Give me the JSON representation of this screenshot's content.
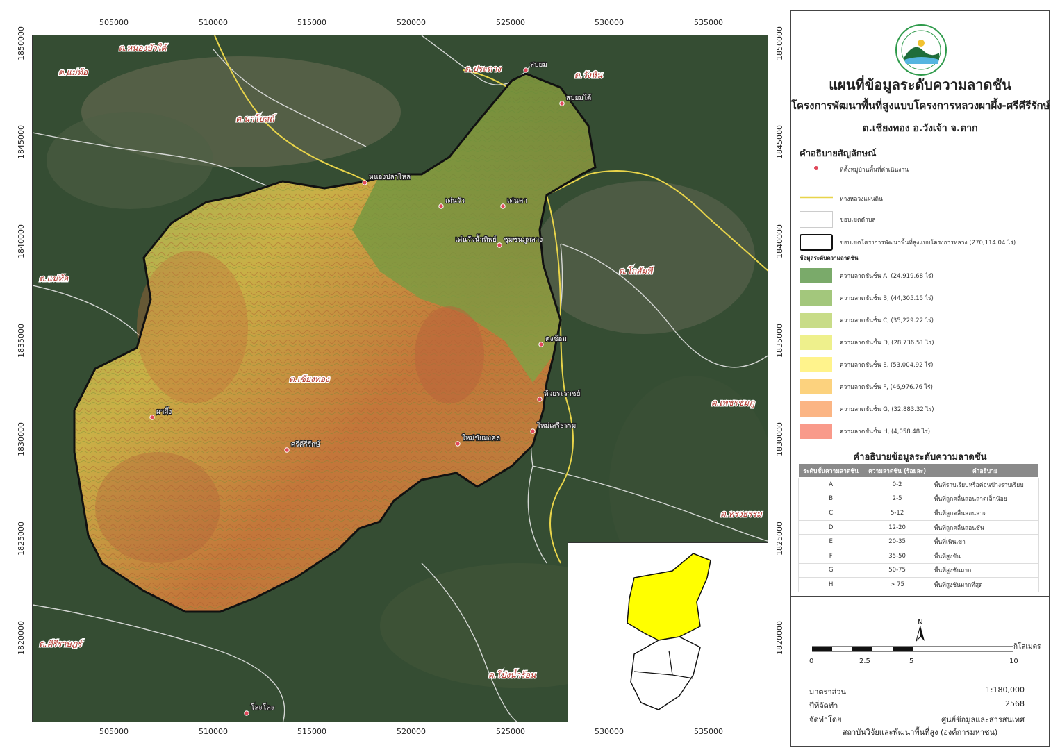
{
  "map": {
    "x_ticks": [
      "505000",
      "510000",
      "515000",
      "520000",
      "525000",
      "530000",
      "535000"
    ],
    "y_ticks": [
      "1850000",
      "1845000",
      "1840000",
      "1835000",
      "1830000",
      "1825000",
      "1820000"
    ],
    "place_labels": [
      {
        "name": "ต.หนองบัวใต้"
      },
      {
        "name": "ต.แม่ท้อ"
      },
      {
        "name": "ต.นาโบสถ์"
      },
      {
        "name": "ต.ประดาง"
      },
      {
        "name": "ต.วังหิน"
      },
      {
        "name": "ต.แม่ท้อ"
      },
      {
        "name": "ต.โกสัมพี"
      },
      {
        "name": "ต.เชียงทอง"
      },
      {
        "name": "ต.เพชรชมภู"
      },
      {
        "name": "ต.ทรงธรรม"
      },
      {
        "name": "ต.คีรีราษฎร์"
      },
      {
        "name": "ต.โป่งน้ำร้อน"
      }
    ],
    "villages": [
      {
        "name": "สบยม"
      },
      {
        "name": "สบยมใต้"
      },
      {
        "name": "หนองปลาไหล"
      },
      {
        "name": "เด่นวัว"
      },
      {
        "name": "เด่นคา"
      },
      {
        "name": "เด่นวัวน้ำทิพย์"
      },
      {
        "name": "ชุมชนภูกลาง"
      },
      {
        "name": "คงซ้อม"
      },
      {
        "name": "ห้วยระราชย์"
      },
      {
        "name": "ใหม่เสรีธรรม"
      },
      {
        "name": "ใหม่ชัยมงคล"
      },
      {
        "name": "ผาผึ้ง"
      },
      {
        "name": "ศรีคีรีรักษ์"
      },
      {
        "name": "โละโคะ"
      }
    ]
  },
  "title": {
    "main": "แผนที่ข้อมูลระดับความลาดชัน",
    "sub": "โครงการพัฒนาพื้นที่สูงแบบโครงการหลวงผาผึ้ง-ศรีคีรีรักษ์",
    "location": "ต.เชียงทอง อ.วังเจ้า จ.ตาก"
  },
  "legend": {
    "title": "คำอธิบายสัญลักษณ์",
    "village": "ที่ตั้งหมู่บ้านพื้นที่ดำเนินงาน",
    "road": "ทางหลวงแผ่นดิน",
    "subdistrict": "ขอบเขตตำบล",
    "project": "ขอบเขตโครงการพัฒนาพื้นที่สูงแบบโครงการหลวง (270,114.04 ไร่)",
    "slope_title": "ข้อมูลระดับความลาดชัน",
    "slope_classes": [
      {
        "label": "ความลาดชันชั้น A, (24,919.68 ไร่)",
        "color": "#7aaa6a"
      },
      {
        "label": "ความลาดชันชั้น B, (44,305.15 ไร่)",
        "color": "#a3c77c"
      },
      {
        "label": "ความลาดชันชั้น C, (35,229.22 ไร่)",
        "color": "#c8dc88"
      },
      {
        "label": "ความลาดชันชั้น D, (28,736.51 ไร่)",
        "color": "#eef08c"
      },
      {
        "label": "ความลาดชันชั้น E, (53,004.92 ไร่)",
        "color": "#fff38c"
      },
      {
        "label": "ความลาดชันชั้น F, (46,976.76 ไร่)",
        "color": "#fcd27e"
      },
      {
        "label": "ความลาดชันชั้น G, (32,883.32 ไร่)",
        "color": "#fbb584"
      },
      {
        "label": "ความลาดชันชั้น H, (4,058.48 ไร่)",
        "color": "#f99a8a"
      }
    ]
  },
  "table": {
    "title": "คำอธิบายข้อมูลระดับความลาดชัน",
    "headers": [
      "ระดับชั้นความลาดชัน",
      "ความลาดชัน (ร้อยละ)",
      "คำอธิบาย"
    ],
    "rows": [
      [
        "A",
        "0-2",
        "พื้นที่ราบเรียบหรือค่อนข้างราบเรียบ"
      ],
      [
        "B",
        "2-5",
        "พื้นที่ลูกคลื่นลอนลาดเล็กน้อย"
      ],
      [
        "C",
        "5-12",
        "พื้นที่ลูกคลื่นลอนลาด"
      ],
      [
        "D",
        "12-20",
        "พื้นที่ลูกคลื่นลอนชัน"
      ],
      [
        "E",
        "20-35",
        "พื้นที่เนินเขา"
      ],
      [
        "F",
        "35-50",
        "พื้นที่สูงชัน"
      ],
      [
        "G",
        "50-75",
        "พื้นที่สูงชันมาก"
      ],
      [
        "H",
        "> 75",
        "พื้นที่สูงชันมากที่สุด"
      ]
    ]
  },
  "scale": {
    "north": "N",
    "ticks": [
      "0",
      "2.5",
      "5",
      "10"
    ],
    "unit": "กิโลเมตร",
    "ratio_label": "มาตราส่วน",
    "ratio_value": "1:180,000",
    "year_label": "ปีที่จัดทำ",
    "year_value": "2568",
    "by_label": "จัดทำโดย",
    "by_value": "ศูนย์ข้อมูลและสารสนเทศ",
    "institute": "สถาบันวิจัยและพัฒนาพื้นที่สูง (องค์การมหาชน)"
  },
  "colors": {
    "road": "#e8d44a",
    "boundary": "#111111",
    "subdistrict": "#e6e6e6",
    "village_marker": "#e0485a",
    "inset_fill": "#ffff00"
  }
}
